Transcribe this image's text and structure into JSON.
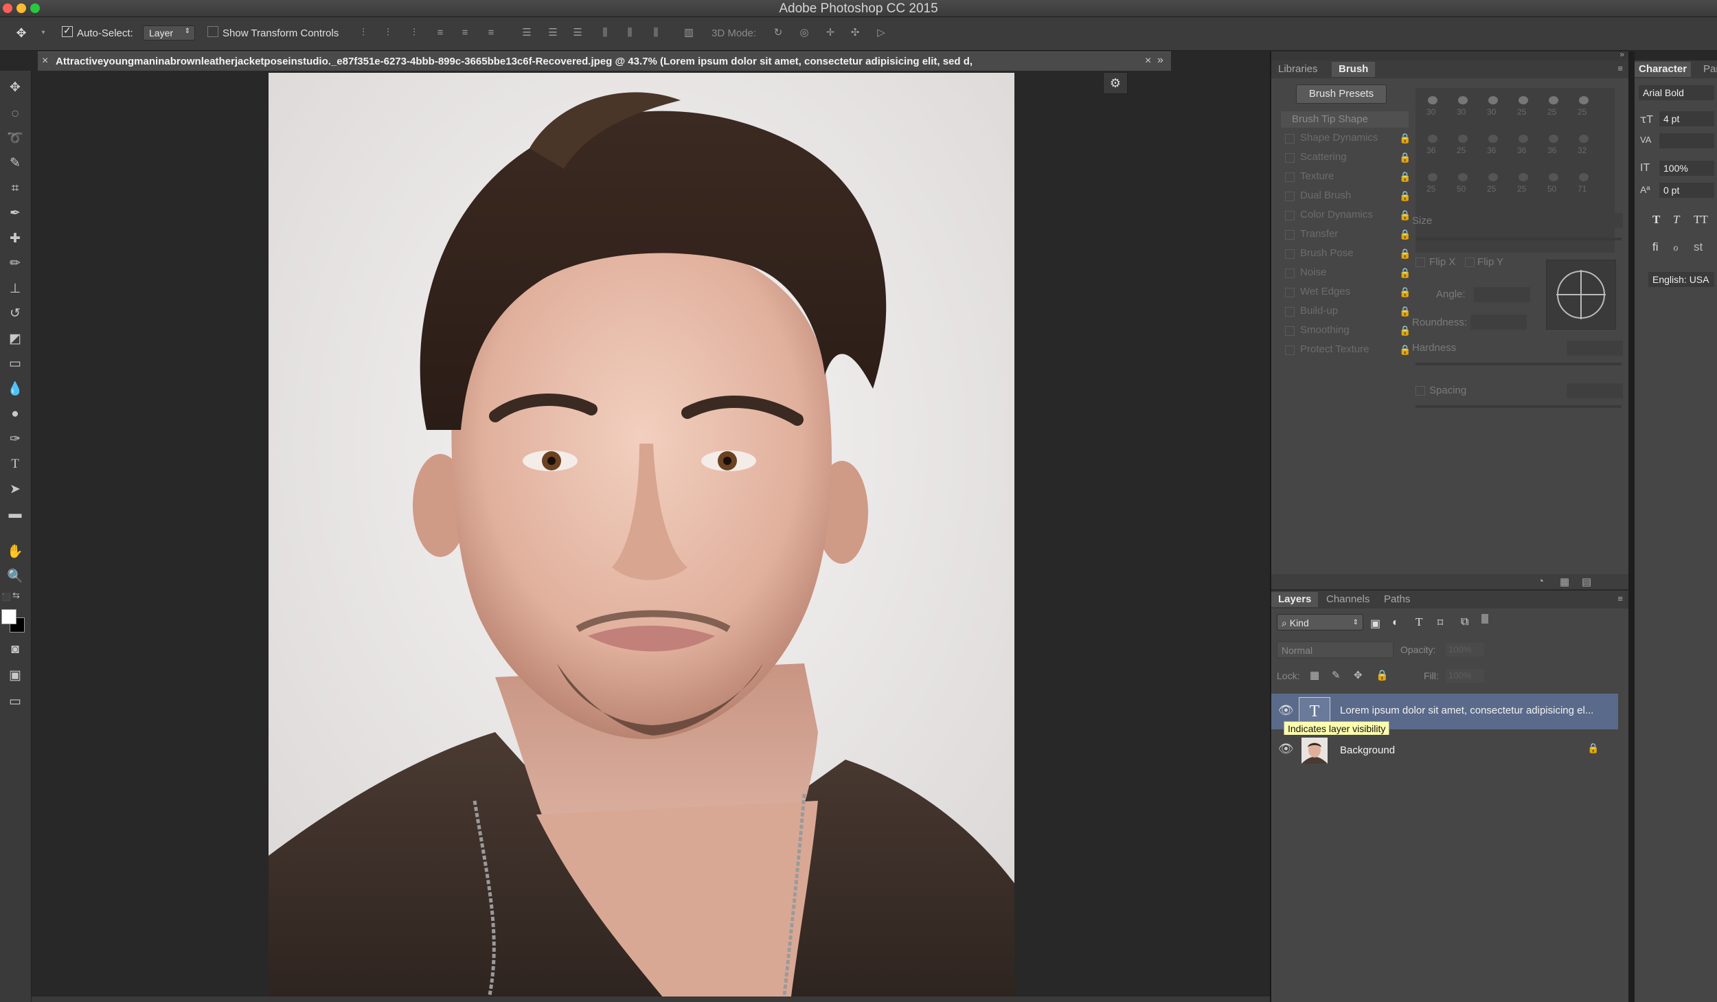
{
  "window": {
    "title": "Adobe Photoshop CC 2015",
    "traffic_colors": [
      "#fe5f57",
      "#febc2e",
      "#28c840"
    ]
  },
  "options_bar": {
    "auto_select_label": "Auto-Select:",
    "auto_select_value": "Layer",
    "show_transform_label": "Show Transform Controls",
    "mode_3d_label": "3D Mode:"
  },
  "document": {
    "tab_title": "Attractiveyoungmaninabrownleatherjacketposeinstudio._e87f351e-6273-4bbb-899c-3665bbe13c6f-Recovered.jpeg @ 43.7% (Lorem ipsum dolor sit amet, consectetur adipisicing elit, sed d,",
    "close_glyph": "×",
    "overflow_glyph": "»"
  },
  "brush_panel": {
    "tabs": [
      "Libraries",
      "Brush"
    ],
    "active_tab": "Brush",
    "presets_button": "Brush Presets",
    "tip_shape_label": "Brush Tip Shape",
    "options": [
      "Shape Dynamics",
      "Scattering",
      "Texture",
      "Dual Brush",
      "Color Dynamics",
      "Transfer",
      "Brush Pose",
      "Noise",
      "Wet Edges",
      "Build-up",
      "Smoothing",
      "Protect Texture"
    ],
    "size_label": "Size",
    "flip_x_label": "Flip X",
    "flip_y_label": "Flip Y",
    "angle_label": "Angle:",
    "roundness_label": "Roundness:",
    "hardness_label": "Hardness",
    "spacing_label": "Spacing",
    "tip_sizes": [
      "30",
      "30",
      "30",
      "25",
      "25",
      "25",
      "36",
      "25",
      "36",
      "36",
      "36",
      "32",
      "25",
      "50",
      "25",
      "25",
      "50",
      "71"
    ]
  },
  "layers_panel": {
    "tabs": [
      "Layers",
      "Channels",
      "Paths"
    ],
    "active_tab": "Layers",
    "filter_kind": "Kind",
    "blend_mode": "Normal",
    "opacity_label": "Opacity:",
    "opacity_value": "100%",
    "lock_label": "Lock:",
    "fill_label": "Fill:",
    "fill_value": "100%",
    "layers": [
      {
        "name": "Lorem ipsum dolor sit amet, consectetur adipisicing el...",
        "type_glyph": "T",
        "selected": true
      },
      {
        "name": "Background",
        "selected": false
      }
    ],
    "tooltip": "Indicates layer visibility"
  },
  "character_panel": {
    "tabs": [
      "Character",
      "Par"
    ],
    "font_family": "Arial Bold",
    "font_size": "4 pt",
    "vertical_scale": "100%",
    "baseline_shift": "0 pt",
    "language": "English: USA"
  },
  "colors": {
    "app_bg": "#282828",
    "panel_bg": "#464646",
    "selected_layer": "#5a6a8a",
    "tooltip_bg": "#fdfdae"
  }
}
